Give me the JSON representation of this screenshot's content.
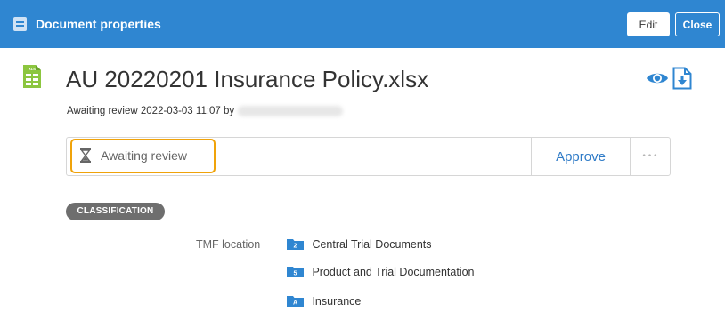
{
  "window": {
    "title": "Document properties",
    "edit_label": "Edit",
    "close_label": "Close",
    "accent_color": "#2f86d1"
  },
  "document": {
    "file_icon": "spreadsheet-file-icon",
    "file_icon_text": "XLS",
    "title": "AU  20220201 Insurance Policy.xlsx",
    "subline": "Awaiting review 2022-03-03 11:07 by",
    "icons": [
      "eye-icon",
      "download-icon"
    ]
  },
  "status": {
    "icon": "hourglass-icon",
    "text": "Awaiting review",
    "highlight_color": "#f0a30a",
    "approve_label": "Approve",
    "more_label": "•••"
  },
  "classification": {
    "badge": "CLASSIFICATION",
    "tmf_label": "TMF location",
    "locations": [
      {
        "code": "2",
        "name": "Central Trial Documents"
      },
      {
        "code": "5",
        "name": "Product and Trial Documentation"
      },
      {
        "code": "A",
        "name": "Insurance"
      }
    ]
  }
}
